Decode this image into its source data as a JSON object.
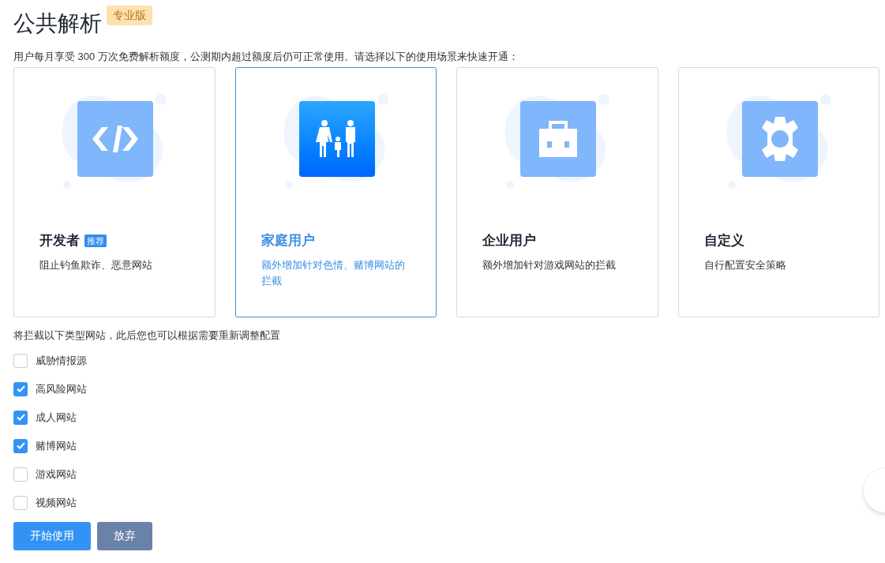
{
  "header": {
    "title": "公共解析",
    "edition_badge": "专业版"
  },
  "description": "用户每月享受 300 万次免费解析额度，公测期内超过额度后仍可正常使用。请选择以下的使用场景来快速开通：",
  "scenarios": [
    {
      "kind": "code",
      "title": "开发者",
      "badge": "推荐",
      "subtitle": "阻止钓鱼欺诈、恶意网站",
      "selected": false
    },
    {
      "kind": "family",
      "title": "家庭用户",
      "subtitle": "额外增加针对色情、赌博网站的拦截",
      "selected": true
    },
    {
      "kind": "briefcase",
      "title": "企业用户",
      "subtitle": "额外增加针对游戏网站的拦截",
      "selected": false
    },
    {
      "kind": "gear",
      "title": "自定义",
      "subtitle": "自行配置安全策略",
      "selected": false
    }
  ],
  "block_note": "将拦截以下类型网站，此后您也可以根据需要重新调整配置",
  "categories": [
    {
      "label": "威胁情报源",
      "checked": false
    },
    {
      "label": "高风险网站",
      "checked": true
    },
    {
      "label": "成人网站",
      "checked": true
    },
    {
      "label": "赌博网站",
      "checked": true
    },
    {
      "label": "游戏网站",
      "checked": false
    },
    {
      "label": "视频网站",
      "checked": false
    }
  ],
  "buttons": {
    "primary": "开始使用",
    "secondary": "放弃"
  }
}
